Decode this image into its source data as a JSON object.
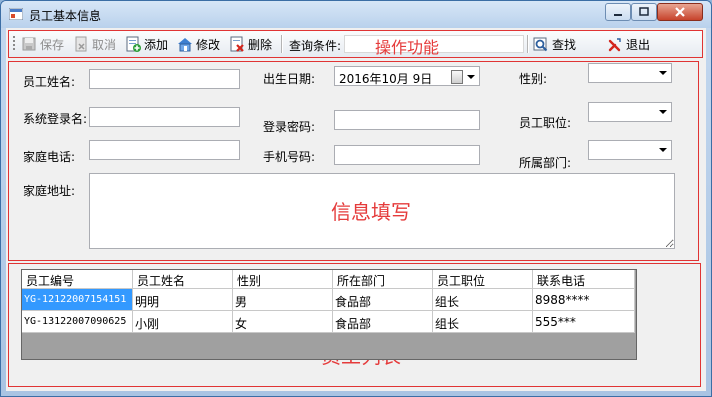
{
  "window": {
    "title": "员工基本信息"
  },
  "toolbar": {
    "save": "保存",
    "cancel": "取消",
    "add": "添加",
    "edit": "修改",
    "delete": "删除",
    "query_label": "查询条件:",
    "query_value": "",
    "search": "查找",
    "exit": "退出"
  },
  "annotations": {
    "toolbar": "操作功能",
    "form": "信息填写",
    "list": "员工列表"
  },
  "form": {
    "name_label": "员工姓名:",
    "name_value": "",
    "birth_label": "出生日期:",
    "birth_value": "2016年10月  9日",
    "gender_label": "性别:",
    "gender_value": "",
    "login_label": "系统登录名:",
    "login_value": "",
    "password_label": "登录密码:",
    "password_value": "",
    "position_label": "员工职位:",
    "position_value": "",
    "home_phone_label": "家庭电话:",
    "home_phone_value": "",
    "mobile_label": "手机号码:",
    "mobile_value": "",
    "dept_label": "所属部门:",
    "dept_value": "",
    "address_label": "家庭地址:",
    "address_value": ""
  },
  "grid": {
    "columns": [
      "员工编号",
      "员工姓名",
      "性别",
      "所在部门",
      "员工职位",
      "联系电话"
    ],
    "rows": [
      [
        "YG-12122007154151",
        "明明",
        "男",
        "食品部",
        "组长",
        "8988****"
      ],
      [
        "YG-13122007090625",
        "小刚",
        "女",
        "食品部",
        "组长",
        "555***"
      ]
    ]
  },
  "colors": {
    "annotation": "#e53b3b",
    "selection": "#3399ff",
    "title_bar": "#c4d8ef"
  }
}
